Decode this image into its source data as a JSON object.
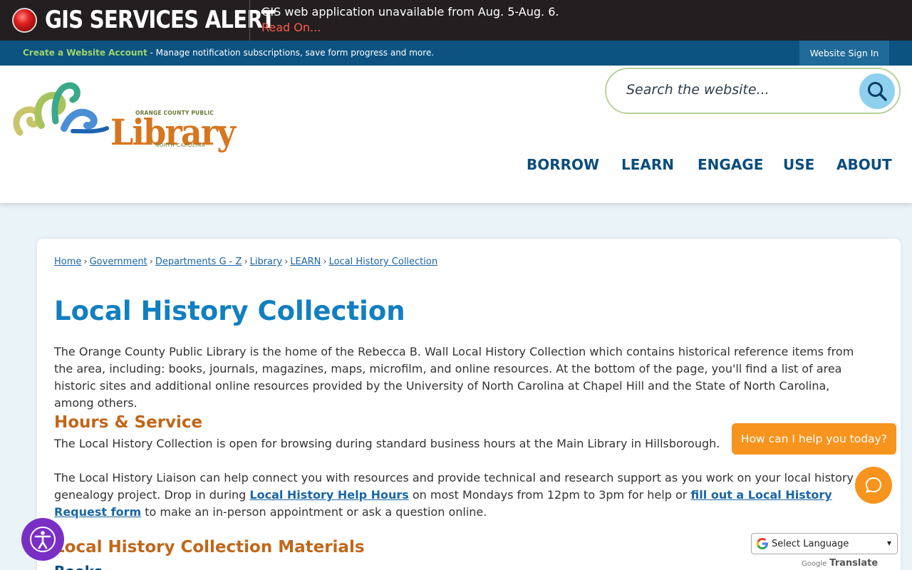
{
  "alert": {
    "title": "GIS SERVICES ALERT",
    "message": "GIS web application unavailable from Aug. 5-Aug. 6.",
    "link": "Read On..."
  },
  "account_bar": {
    "create_link": "Create a Website Account",
    "description": " - Manage notification subscriptions, save form progress and more.",
    "sign_in": "Website Sign In"
  },
  "logo": {
    "top_line": "ORANGE COUNTY PUBLIC",
    "word": "Library",
    "bottom_line": "NORTH CAROLINA"
  },
  "search": {
    "placeholder": "Search the website..."
  },
  "nav": {
    "items": [
      "BORROW",
      "LEARN",
      "ENGAGE",
      "USE",
      "ABOUT"
    ]
  },
  "breadcrumb": [
    "Home",
    "Government",
    "Departments G - Z",
    "Library",
    "LEARN",
    "Local History Collection"
  ],
  "page": {
    "title": "Local History Collection",
    "intro": "The Orange County Public Library is the home of the Rebecca B. Wall Local History Collection which contains historical reference items from the area, including: books, journals, magazines, maps, microfilm, and online resources. At the bottom of the page, you'll find a list of area historic sites and additional online resources provided by the University of North Carolina at Chapel Hill and the State of North Carolina, among others.",
    "hours_heading": "Hours & Service",
    "hours_text": "The Local History Collection is open for browsing during standard business hours at the Main Library in Hillsborough.",
    "liaison_text_1": "The Local History Liaison can help connect you with resources and provide technical and research support as you work on your local history or genealogy project. Drop in during ",
    "liaison_link_1": "Local History Help Hours",
    "liaison_text_2": " on most Mondays from 12pm to 3pm for help or ",
    "liaison_link_2": "fill out a Local History Request form",
    "liaison_text_3": " to make an in-person appointment or ask a question online.",
    "materials_heading": "Local History Collection Materials",
    "books_heading": "Books"
  },
  "chat": {
    "prompt": "How can I help you today?"
  },
  "translate": {
    "select_label": "Select Language",
    "powered_by": "Google",
    "translate_word": "Translate"
  },
  "colors": {
    "alert_bg": "#231f20",
    "account_bar": "#0c5382",
    "nav_text": "#0c4d7c",
    "title_blue": "#117fc0",
    "heading_orange": "#c0671a",
    "chat_orange": "#f7941d",
    "accessibility_purple": "#7a2fc4"
  },
  "icons": {
    "alert": "red-alert-light-icon",
    "search": "magnifier-icon",
    "chat": "speech-bubble-icon",
    "accessibility": "accessibility-person-icon",
    "google": "google-g-icon"
  }
}
